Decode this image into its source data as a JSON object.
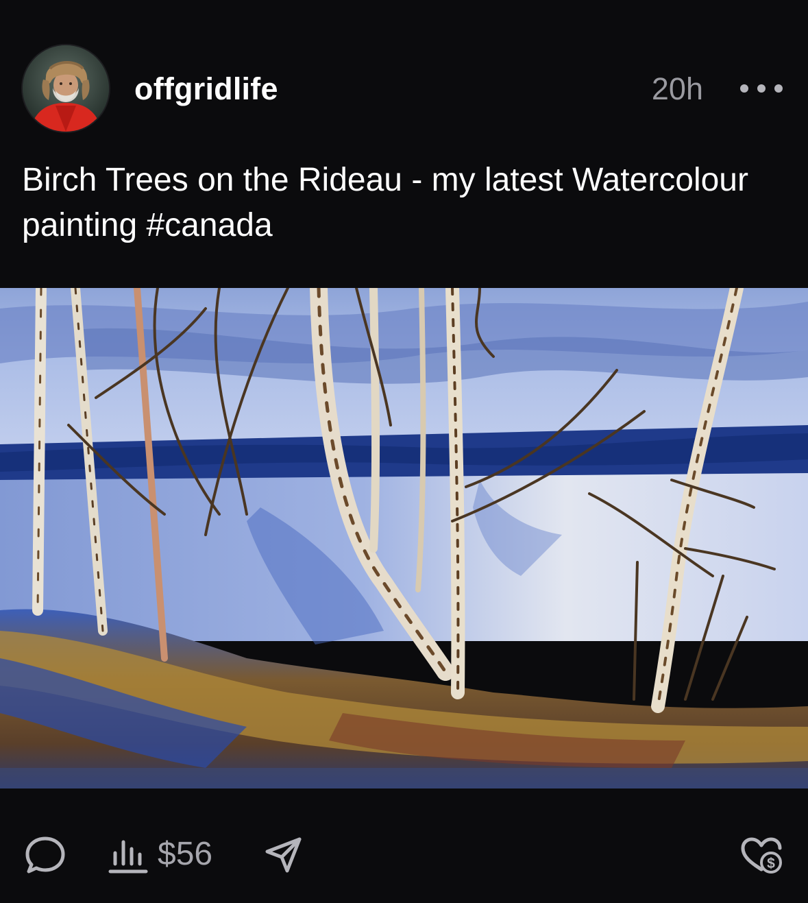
{
  "post": {
    "username": "offgridlife",
    "timestamp": "20h",
    "caption": "Birch Trees on the Rideau - my latest Watercolour painting ",
    "hashtag": "#canada",
    "more_icon": "more-horizontal-icon",
    "image_alt": "Birch Trees on the Rideau"
  },
  "actions": {
    "comment_icon": "comment-bubble-icon",
    "stats_icon": "bar-chart-icon",
    "stats_value": "$56",
    "share_icon": "paper-plane-icon",
    "tip_icon": "heart-dollar-icon"
  },
  "colors": {
    "background": "#0b0b0d",
    "text_primary": "#ffffff",
    "text_secondary": "#9a9aa0",
    "icon": "#b5b5bb"
  }
}
